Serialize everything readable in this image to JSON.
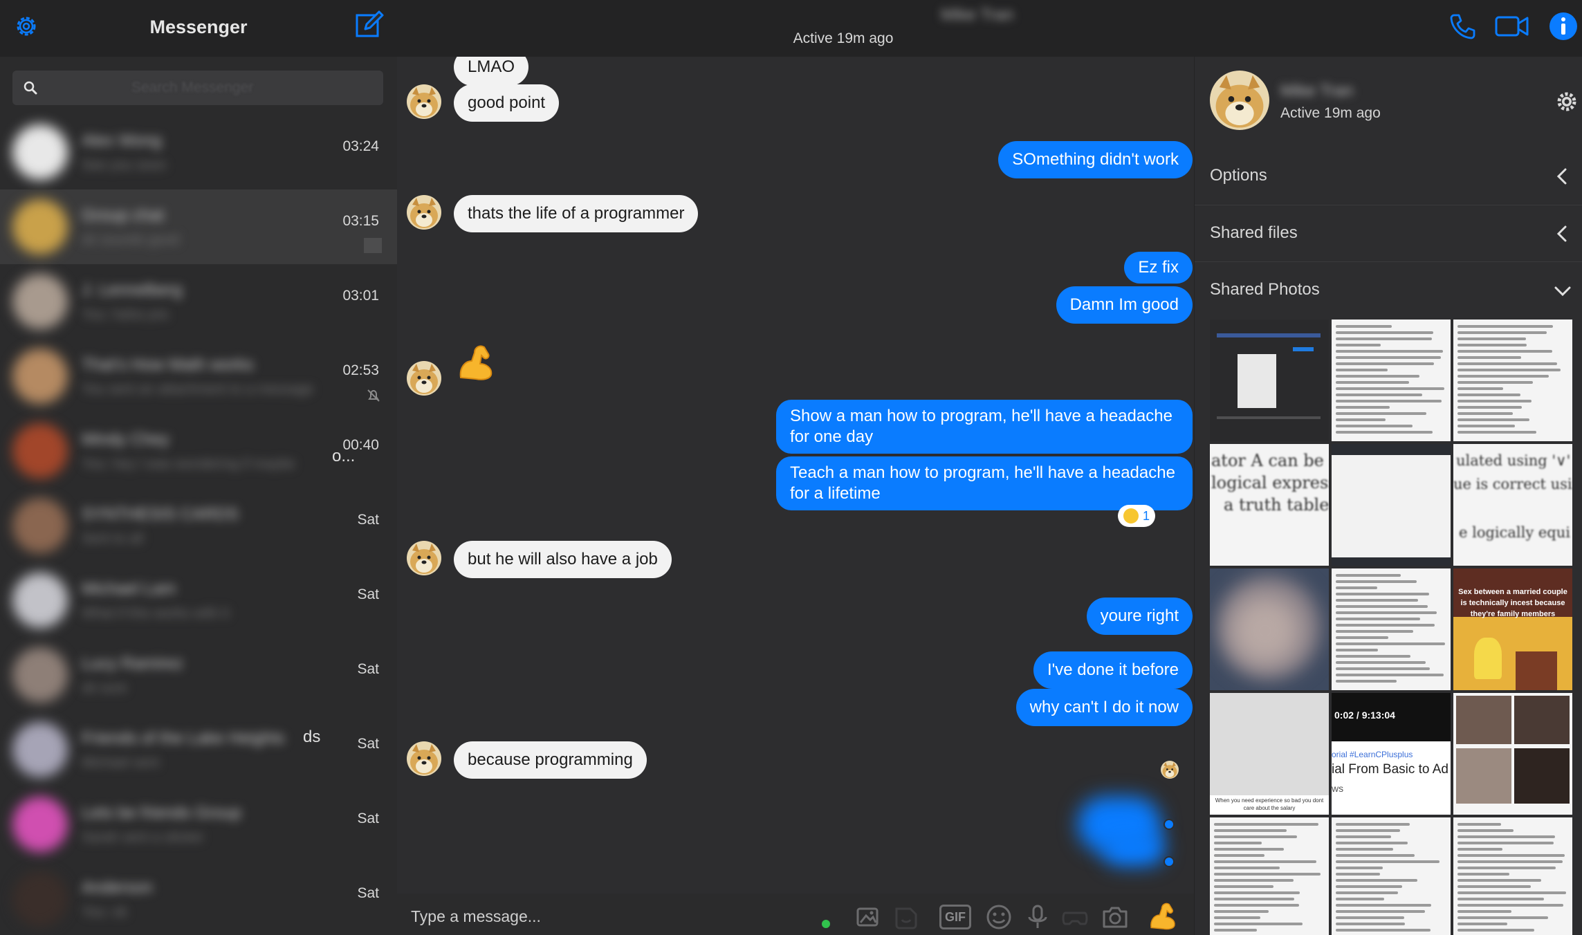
{
  "sidebar": {
    "title": "Messenger",
    "search_placeholder": "Search Messenger",
    "conversations": [
      {
        "time": "03:24",
        "avatar_color": "#e8e8e8",
        "name": "Alex Wong",
        "snippet": "See you soon"
      },
      {
        "time": "03:15",
        "avatar_color": "#c9a14a",
        "name": "Group chat",
        "snippet": "ok sounds good",
        "active": true
      },
      {
        "time": "03:01",
        "avatar_color": "#a89a8e",
        "name": "J. Lennelberg",
        "snippet": "You: haha yes"
      },
      {
        "time": "02:53",
        "avatar_color": "#b58a62",
        "name": "That's How Math works",
        "snippet": "You sent an attachment to a message",
        "muted": true
      },
      {
        "time": "00:40",
        "avatar_color": "#a2462a",
        "name": "Mindy Chey",
        "snippet": "You: hey I was wondering if maybe",
        "overflow_text": "o..."
      },
      {
        "time": "Sat",
        "avatar_color": "#8a6650",
        "name": "SYNTHESIS CARDS",
        "snippet": "Sent to all"
      },
      {
        "time": "Sat",
        "avatar_color": "#c2c2c8",
        "name": "Michael Lam",
        "snippet": "What if this works with it"
      },
      {
        "time": "Sat",
        "avatar_color": "#8e7f77",
        "name": "Lucy Ramirez",
        "snippet": "ok sure"
      },
      {
        "time": "Sat",
        "avatar_color": "#a6a4b6",
        "name": "Friends of the Lake Heights",
        "snippet": "Michael sent",
        "overflow_text": "ds"
      },
      {
        "time": "Sat",
        "avatar_color": "#d04fb0",
        "name": "Lets be friends Group",
        "snippet": "Sarah sent a sticker"
      },
      {
        "time": "Sat",
        "avatar_color": "#3a2e2a",
        "name": "Anderson",
        "snippet": "You: ok"
      }
    ]
  },
  "topbar": {
    "contact_name": "Mike Tran",
    "status": "Active 19m ago"
  },
  "chat": {
    "messages": [
      {
        "from": "in",
        "text": "LMAO"
      },
      {
        "from": "in",
        "text": "good point"
      },
      {
        "from": "out",
        "text": "SOmething didn't work"
      },
      {
        "from": "in",
        "text": "thats the life of a programmer"
      },
      {
        "from": "out",
        "text": "Ez fix"
      },
      {
        "from": "out",
        "text": "Damn Im good"
      },
      {
        "from": "in",
        "emoji": "flexed-biceps"
      },
      {
        "from": "out",
        "text": "Show a man how to program, he'll have a headache for one day"
      },
      {
        "from": "out",
        "text": "Teach a man how to program, he'll have a headache for a lifetime",
        "reaction_count": "1"
      },
      {
        "from": "in",
        "text": "but he will also have a job"
      },
      {
        "from": "out",
        "text": "youre right"
      },
      {
        "from": "out",
        "text": "I've done it before"
      },
      {
        "from": "out",
        "text": "why can't I do it now"
      },
      {
        "from": "in",
        "text": "because programming"
      }
    ]
  },
  "composer": {
    "placeholder": "Type a message...",
    "gif_label": "GIF"
  },
  "rpanel": {
    "name": "Mike Tran",
    "status": "Active 19m ago",
    "options_label": "Options",
    "files_label": "Shared files",
    "photos_label": "Shared Photos",
    "photo_captions": {
      "p4_a": "ator A can be s",
      "p4_b": "logical expressi",
      "p4_c": "a truth table.",
      "p6_a": "ulated using '∨' an",
      "p6_b": "ue is correct using",
      "p6_c": "e logically equi",
      "p9": "Sex between a married couple is technically incest because they're family members",
      "p11_time": "0:02 / 9:13:04",
      "p11_tag": "orial #LearnCPlusplus",
      "p11_title": "ial From Basic to Ad",
      "p11_sub": "ws",
      "p10_caption": "When you need experience so bad you dont care about the salary"
    }
  },
  "colors": {
    "accent": "#0a7cff",
    "incoming_bubble": "#f2f2f2",
    "background": "#2d2d2f",
    "header": "#232324"
  }
}
